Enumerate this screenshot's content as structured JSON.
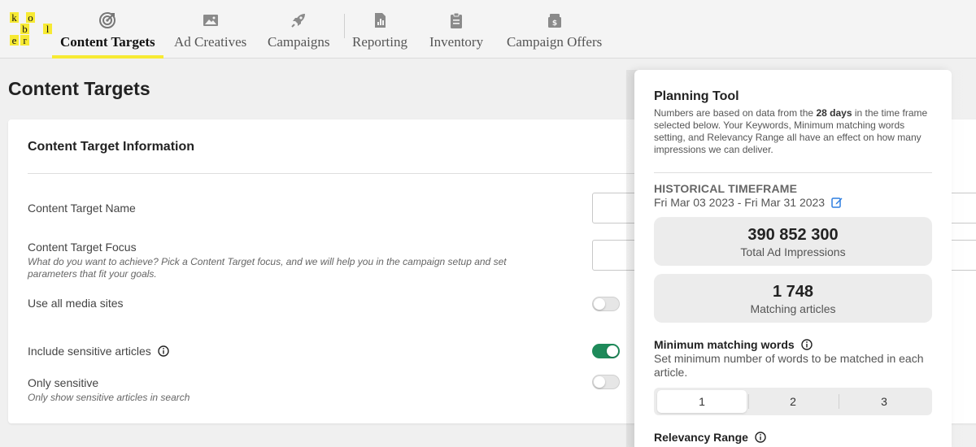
{
  "logo": {
    "letters": [
      "k",
      "o",
      "b",
      "l",
      "e",
      "r"
    ]
  },
  "nav": {
    "items": [
      {
        "label": "Content Targets",
        "icon": "target-icon"
      },
      {
        "label": "Ad Creatives",
        "icon": "image-icon"
      },
      {
        "label": "Campaigns",
        "icon": "rocket-icon"
      },
      {
        "label": "Reporting",
        "icon": "report-icon"
      },
      {
        "label": "Inventory",
        "icon": "clipboard-icon"
      },
      {
        "label": "Campaign Offers",
        "icon": "dollar-box-icon"
      }
    ],
    "active": "Content Targets"
  },
  "page": {
    "title": "Content Targets"
  },
  "form": {
    "title": "Content Target Information",
    "name_label": "Content Target Name",
    "focus_label": "Content Target Focus",
    "focus_help": "What do you want to achieve? Pick a Content Target focus, and we will help you in the campaign setup and set parameters that fit your goals.",
    "media_label": "Use all media sites",
    "media_on": false,
    "sensitive_label": "Include sensitive articles",
    "sensitive_on": true,
    "only_sensitive_label": "Only sensitive",
    "only_sensitive_help": "Only show sensitive articles in search",
    "only_sensitive_on": false
  },
  "planning": {
    "title": "Planning Tool",
    "desc_pre": "Numbers are based on data from the ",
    "desc_bold": "28 days",
    "desc_post": " in the time frame selected below. Your Keywords, Minimum matching words setting, and Relevancy Range all have an effect on how many impressions we can deliver.",
    "timeframe_heading": "HISTORICAL TIMEFRAME",
    "timeframe_range": "Fri Mar 03 2023 - Fri Mar 31 2023",
    "impressions_value": "390 852 300",
    "impressions_label": "Total Ad Impressions",
    "articles_value": "1 748",
    "articles_label": "Matching articles",
    "min_words_title": "Minimum matching words",
    "min_words_desc": "Set minimum number of words to be matched in each article.",
    "min_words_options": [
      "1",
      "2",
      "3"
    ],
    "min_words_selected": "1",
    "relevancy_title": "Relevancy Range"
  },
  "colors": {
    "accent_yellow": "#f7ea33",
    "toggle_on": "#1e8a5a",
    "edit_blue": "#2f7fe0"
  }
}
